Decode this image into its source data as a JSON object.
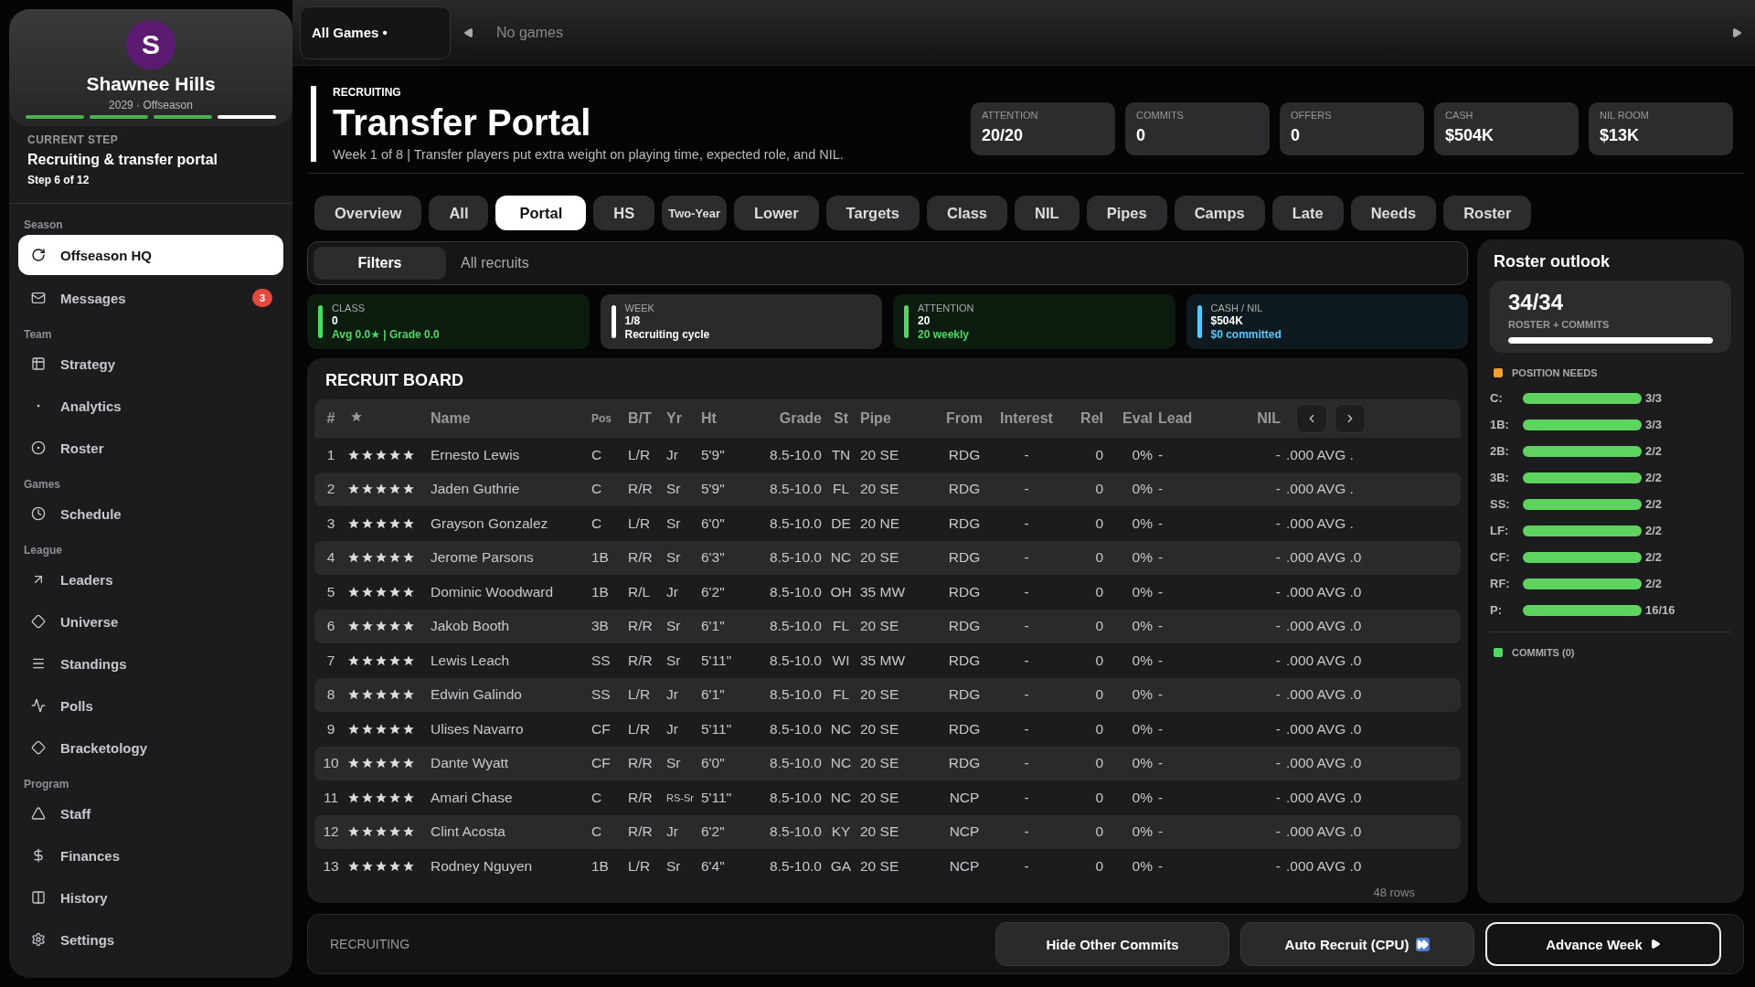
{
  "sidebar": {
    "avatar": "S",
    "team": "Shawnee Hills",
    "season": "2029 · Offseason",
    "progress": [
      {
        "color": "#4caf50"
      },
      {
        "color": "#4caf50"
      },
      {
        "color": "#4caf50"
      },
      {
        "color": "#ffffff"
      }
    ],
    "current_step": {
      "label": "CURRENT STEP",
      "title": "Recruiting & transfer portal",
      "step": "Step 6 of 12"
    },
    "sections": [
      {
        "title": "Season",
        "items": [
          {
            "label": "Offseason HQ",
            "selected": true
          },
          {
            "label": "Messages",
            "selected": false,
            "badge": "3"
          }
        ]
      },
      {
        "title": "Team",
        "items": [
          {
            "label": "Strategy",
            "selected": false
          },
          {
            "label": "Analytics",
            "selected": false
          },
          {
            "label": "Roster",
            "selected": false
          }
        ]
      },
      {
        "title": "Games",
        "items": [
          {
            "label": "Schedule",
            "selected": false
          }
        ]
      },
      {
        "title": "League",
        "items": [
          {
            "label": "Leaders",
            "selected": false
          },
          {
            "label": "Universe",
            "selected": false
          },
          {
            "label": "Standings",
            "selected": false
          },
          {
            "label": "Polls",
            "selected": false
          },
          {
            "label": "Bracketology",
            "selected": false
          }
        ]
      },
      {
        "title": "Program",
        "items": [
          {
            "label": "Staff",
            "selected": false
          },
          {
            "label": "Finances",
            "selected": false
          },
          {
            "label": "History",
            "selected": false
          },
          {
            "label": "Settings",
            "selected": false
          }
        ]
      }
    ]
  },
  "topbar": {
    "filter": "All Games •",
    "games": "No games"
  },
  "header": {
    "eyebrow": "RECRUITING",
    "title": "Transfer Portal",
    "subtitle": "Week 1 of 8 | Transfer players put extra weight on playing time, expected role, and NIL.",
    "stats": [
      {
        "label": "ATTENTION",
        "value": "20/20"
      },
      {
        "label": "COMMITS",
        "value": "0"
      },
      {
        "label": "OFFERS",
        "value": "0"
      },
      {
        "label": "CASH",
        "value": "$504K"
      },
      {
        "label": "NIL ROOM",
        "value": "$13K"
      }
    ]
  },
  "tabs": [
    {
      "label": "Overview",
      "selected": false,
      "kind": "normal"
    },
    {
      "label": "All",
      "selected": false,
      "kind": "normal"
    },
    {
      "label": "Portal",
      "selected": true,
      "kind": "normal"
    },
    {
      "label": "HS",
      "selected": false,
      "kind": "normal"
    },
    {
      "label": "Two-Year",
      "selected": false,
      "kind": "compact"
    },
    {
      "label": "Lower",
      "selected": false
    },
    {
      "label": "Targets",
      "selected": false
    },
    {
      "label": "Class",
      "selected": false
    },
    {
      "label": "NIL",
      "selected": false
    },
    {
      "label": "Pipes",
      "selected": false
    },
    {
      "label": "Camps",
      "selected": false
    },
    {
      "label": "Late",
      "selected": false
    },
    {
      "label": "Needs",
      "selected": false
    },
    {
      "label": "Roster",
      "selected": false
    }
  ],
  "filters": {
    "button": "Filters",
    "value": "All recruits"
  },
  "summary": [
    {
      "label": "CLASS",
      "value": "0",
      "sub": "Avg 0.0★ | Grade 0.0",
      "color": "#4cd964"
    },
    {
      "label": "WEEK",
      "value": "1/8",
      "sub": "Recruiting cycle",
      "color": "#ffffff"
    },
    {
      "label": "ATTENTION",
      "value": "20",
      "sub": "20 weekly",
      "color": "#4cd964"
    },
    {
      "label": "CASH / NIL",
      "value": "$504K",
      "sub": "$0 committed",
      "color": "#5ac8fa"
    }
  ],
  "board": {
    "title": "RECRUIT BOARD",
    "columns": [
      "#",
      "Name",
      "Pos",
      "B/T",
      "Yr",
      "Ht",
      "Grade",
      "St",
      "Pipe",
      "From",
      "Interest",
      "Rel",
      "Eval",
      "Lead",
      "NIL"
    ],
    "rows": [
      {
        "n": "1",
        "stars": 5,
        "name": "Ernesto Lewis",
        "pos": "C",
        "bt": "L/R",
        "yr": "Jr",
        "ht": "5'9\"",
        "grade": "8.5-10.0",
        "st": "TN",
        "pipe": "20 SE",
        "from": "RDG",
        "interest": "-",
        "rel": "0",
        "eval": "0%",
        "lead": "-",
        "nil": "-",
        "column_17": ".000 AVG ."
      },
      {
        "n": "2",
        "stars": 5,
        "name": "Jaden Guthrie",
        "pos": "C",
        "bt": "R/R",
        "yr": "Sr",
        "ht": "5'9\"",
        "grade": "8.5-10.0",
        "st": "FL",
        "pipe": "20 SE",
        "from": "RDG",
        "interest": "-",
        "rel": "0",
        "eval": "0%",
        "lead": "-",
        "nil": "-",
        "column_17": ".000 AVG ."
      },
      {
        "n": "3",
        "stars": 5,
        "name": "Grayson Gonzalez",
        "pos": "C",
        "bt": "L/R",
        "yr": "Sr",
        "ht": "6'0\"",
        "grade": "8.5-10.0",
        "st": "DE",
        "pipe": "20 NE",
        "from": "RDG",
        "interest": "-",
        "rel": "0",
        "eval": "0%",
        "lead": "-",
        "nil": "-",
        "column_17": ".000 AVG ."
      },
      {
        "n": "4",
        "stars": 5,
        "name": "Jerome Parsons",
        "pos": "1B",
        "bt": "R/R",
        "yr": "Sr",
        "ht": "6'3\"",
        "grade": "8.5-10.0",
        "st": "NC",
        "pipe": "20 SE",
        "from": "RDG",
        "interest": "-",
        "rel": "0",
        "eval": "0%",
        "lead": "-",
        "nil": "-",
        "column_17": ".000 AVG .0"
      },
      {
        "n": "5",
        "stars": 5,
        "name": "Dominic Woodward",
        "pos": "1B",
        "bt": "R/L",
        "yr": "Jr",
        "ht": "6'2\"",
        "grade": "8.5-10.0",
        "st": "OH",
        "pipe": "35 MW",
        "from": "RDG",
        "interest": "-",
        "rel": "0",
        "eval": "0%",
        "lead": "-",
        "nil": "-",
        "column_17": ".000 AVG .0"
      },
      {
        "n": "6",
        "stars": 5,
        "name": "Jakob Booth",
        "pos": "3B",
        "bt": "R/R",
        "yr": "Sr",
        "ht": "6'1\"",
        "grade": "8.5-10.0",
        "st": "FL",
        "pipe": "20 SE",
        "from": "RDG",
        "interest": "-",
        "rel": "0",
        "eval": "0%",
        "lead": "-",
        "nil": "-",
        "column_17": ".000 AVG .0"
      },
      {
        "n": "7",
        "stars": 5,
        "name": "Lewis Leach",
        "pos": "SS",
        "bt": "R/R",
        "yr": "Sr",
        "ht": "5'11\"",
        "grade": "8.5-10.0",
        "st": "WI",
        "pipe": "35 MW",
        "from": "RDG",
        "interest": "-",
        "rel": "0",
        "eval": "0%",
        "lead": "-",
        "nil": "-",
        "column_17": ".000 AVG .0"
      },
      {
        "n": "8",
        "stars": 5,
        "name": "Edwin Galindo",
        "pos": "SS",
        "bt": "L/R",
        "yr": "Jr",
        "ht": "6'1\"",
        "grade": "8.5-10.0",
        "st": "FL",
        "pipe": "20 SE",
        "from": "RDG",
        "interest": "-",
        "rel": "0",
        "eval": "0%",
        "lead": "-",
        "nil": "-",
        "column_17": ".000 AVG .0"
      },
      {
        "n": "9",
        "stars": 5,
        "name": "Ulises Navarro",
        "pos": "CF",
        "bt": "L/R",
        "yr": "Jr",
        "ht": "5'11\"",
        "grade": "8.5-10.0",
        "st": "NC",
        "pipe": "20 SE",
        "from": "RDG",
        "interest": "-",
        "rel": "0",
        "eval": "0%",
        "lead": "-",
        "nil": "-",
        "column_17": ".000 AVG .0"
      },
      {
        "n": "10",
        "stars": 5,
        "name": "Dante Wyatt",
        "pos": "CF",
        "bt": "R/R",
        "yr": "Sr",
        "ht": "6'0\"",
        "grade": "8.5-10.0",
        "st": "NC",
        "pipe": "20 SE",
        "from": "RDG",
        "interest": "-",
        "rel": "0",
        "eval": "0%",
        "lead": "-",
        "nil": "-",
        "column_17": ".000 AVG .0"
      },
      {
        "n": "11",
        "stars": 5,
        "name": "Amari Chase",
        "pos": "C",
        "bt": "R/R",
        "yr": "RS-Sr",
        "ht": "5'11\"",
        "grade": "8.5-10.0",
        "st": "NC",
        "pipe": "20 SE",
        "from": "NCP",
        "interest": "-",
        "rel": "0",
        "eval": "0%",
        "lead": "-",
        "nil": "-",
        "column_17": ".000 AVG .0"
      },
      {
        "n": "12",
        "stars": 5,
        "name": "Clint Acosta",
        "pos": "C",
        "bt": "R/R",
        "yr": "Jr",
        "ht": "6'2\"",
        "grade": "8.5-10.0",
        "st": "KY",
        "pipe": "20 SE",
        "from": "NCP",
        "interest": "-",
        "rel": "0",
        "eval": "0%",
        "lead": "-",
        "nil": "-",
        "column_17": ".000 AVG .0"
      },
      {
        "n": "13",
        "stars": 5,
        "name": "Rodney Nguyen",
        "pos": "1B",
        "bt": "L/R",
        "yr": "Sr",
        "ht": "6'4\"",
        "grade": "8.5-10.0",
        "st": "GA",
        "pipe": "20 SE",
        "from": "NCP",
        "interest": "-",
        "rel": "0",
        "eval": "0%",
        "lead": "-",
        "nil": "-",
        "column_17": ".000 AVG .0"
      }
    ],
    "count": "48 rows"
  },
  "outlook": {
    "title": "Roster outlook",
    "total": "34/34",
    "total_label": "ROSTER + COMMITS",
    "level": 1,
    "needs_title": "POSITION NEEDS",
    "needs": [
      {
        "pos": "C:",
        "level": 1,
        "count": "3/3"
      },
      {
        "pos": "1B:",
        "level": 1,
        "count": "3/3"
      },
      {
        "pos": "2B:",
        "level": 1,
        "count": "2/2"
      },
      {
        "pos": "3B:",
        "level": 1,
        "count": "2/2"
      },
      {
        "pos": "SS:",
        "level": 1,
        "count": "2/2"
      },
      {
        "pos": "LF:",
        "level": 1,
        "count": "2/2"
      },
      {
        "pos": "CF:",
        "level": 1,
        "count": "2/2"
      },
      {
        "pos": "RF:",
        "level": 1,
        "count": "2/2"
      },
      {
        "pos": "P:",
        "level": 1,
        "count": "16/16"
      }
    ],
    "commits_title": "COMMITS (0)"
  },
  "footer": {
    "label": "RECRUITING",
    "buttons": [
      {
        "label": "Hide Other Commits",
        "kind": "plain"
      },
      {
        "label": "Auto Recruit (CPU)",
        "kind": "auto"
      },
      {
        "label": "Advance Week",
        "kind": "primary"
      }
    ]
  }
}
